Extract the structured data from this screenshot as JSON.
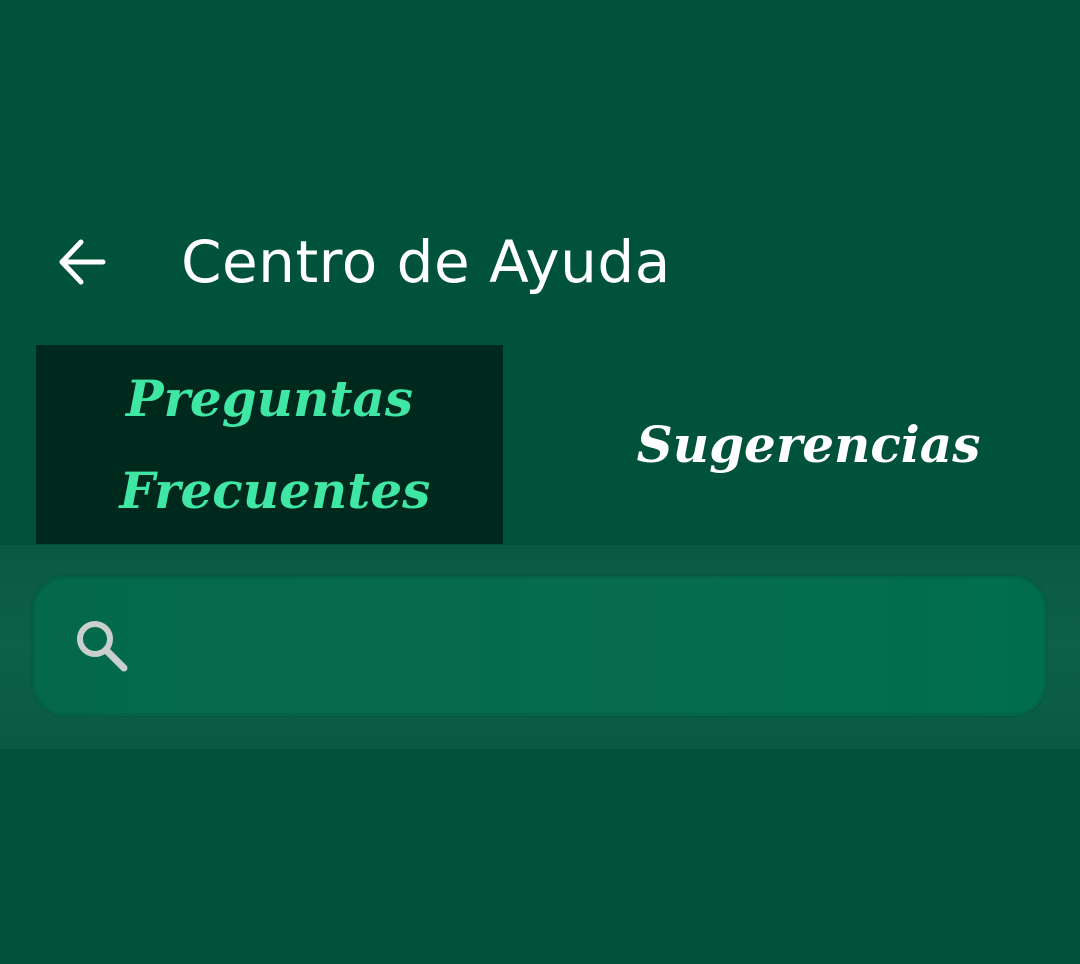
{
  "header": {
    "title": "Centro de Ayuda",
    "back_icon": "arrow-left-icon"
  },
  "tabs": [
    {
      "label": "Preguntas Frecuentes",
      "selected": true
    },
    {
      "label": "Sugerencias",
      "selected": false
    }
  ],
  "search": {
    "icon": "search-icon",
    "value": "",
    "placeholder": ""
  },
  "colors": {
    "background": "#00533a",
    "selected_tab_bg": "#00291d",
    "selected_tab_text": "#3fe6a4",
    "unselected_tab_text": "#ffffff",
    "search_box": "#076c4e",
    "icon_gray": "#c8cfcc"
  }
}
